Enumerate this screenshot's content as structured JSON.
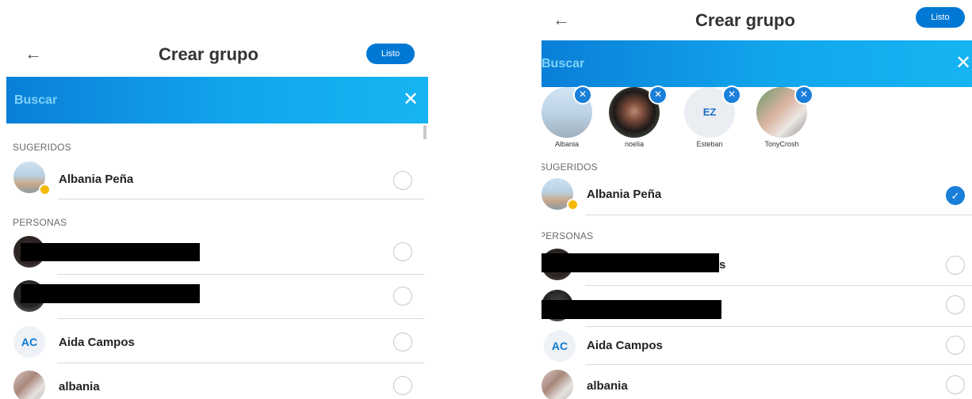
{
  "left": {
    "title": "Crear grupo",
    "back_icon": "←",
    "done_label": "Listo",
    "search": {
      "placeholder": "Buscar",
      "close_icon": "✕"
    },
    "suggested_header": "SUGERIDOS",
    "people_header": "PERSONAS",
    "suggested": [
      {
        "name": "Albania Peña",
        "selected": false,
        "status": "away"
      }
    ],
    "people": [
      {
        "name": "",
        "redacted": true,
        "selected": false
      },
      {
        "name": "",
        "redacted": true,
        "selected": false
      },
      {
        "name": "Aida Campos",
        "initials": "AC",
        "selected": false
      },
      {
        "name": "albania",
        "selected": false
      }
    ]
  },
  "right": {
    "title": "Crear grupo",
    "back_icon": "←",
    "done_label": "Listo",
    "search": {
      "placeholder": "Buscar",
      "close_icon": "✕"
    },
    "selected_chips": [
      {
        "label": "Albania"
      },
      {
        "label": "noelia"
      },
      {
        "label": "Esteban",
        "initials": "EZ"
      },
      {
        "label": "TonyCrosh"
      }
    ],
    "suggested_header": "SUGERIDOS",
    "people_header": "PERSONAS",
    "suggested": [
      {
        "name": "Albania Peña",
        "selected": true,
        "status": "away"
      }
    ],
    "people": [
      {
        "name": "s",
        "redacted": true,
        "selected": false
      },
      {
        "name": "",
        "redacted": true,
        "selected": false
      },
      {
        "name": "Aida Campos",
        "initials": "AC",
        "selected": false
      },
      {
        "name": "albania",
        "selected": false
      }
    ]
  },
  "icons": {
    "check": "✓",
    "remove": "✕"
  },
  "colors": {
    "accent": "#0078d4",
    "status_away": "#f5b800"
  }
}
